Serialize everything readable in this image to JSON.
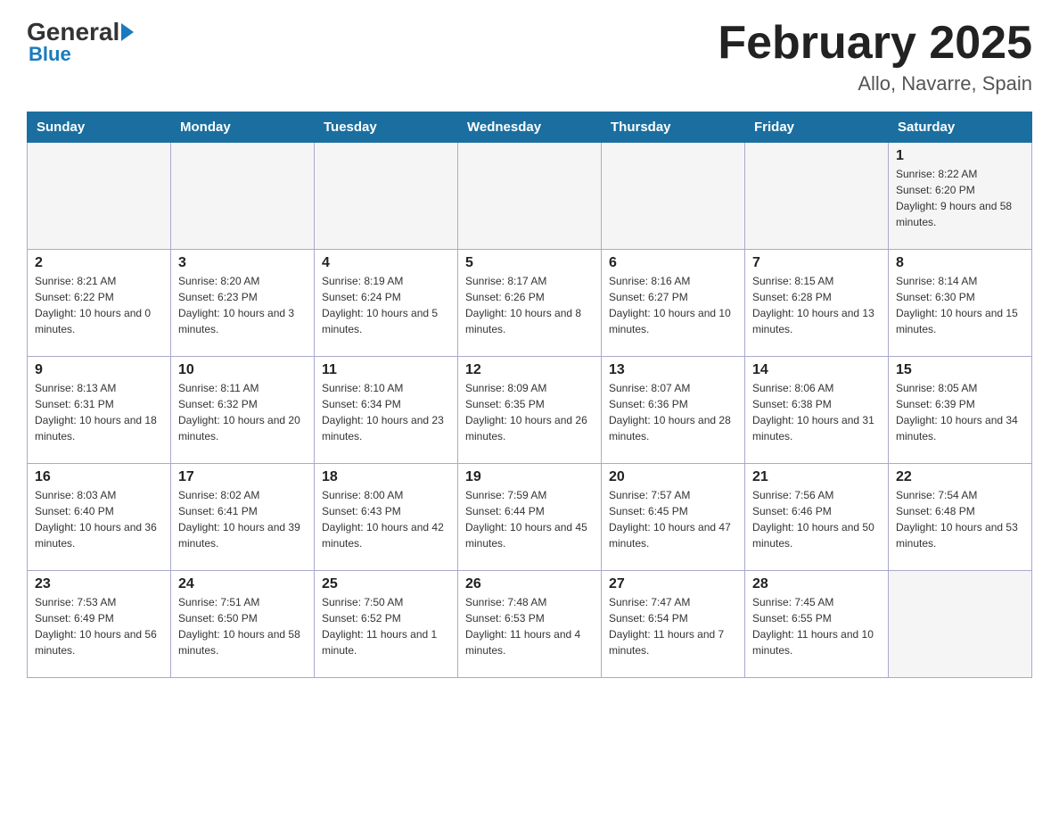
{
  "header": {
    "logo_general": "General",
    "logo_blue": "Blue",
    "month_title": "February 2025",
    "location": "Allo, Navarre, Spain"
  },
  "days_of_week": [
    "Sunday",
    "Monday",
    "Tuesday",
    "Wednesday",
    "Thursday",
    "Friday",
    "Saturday"
  ],
  "weeks": [
    {
      "days": [
        {
          "number": "",
          "info": ""
        },
        {
          "number": "",
          "info": ""
        },
        {
          "number": "",
          "info": ""
        },
        {
          "number": "",
          "info": ""
        },
        {
          "number": "",
          "info": ""
        },
        {
          "number": "",
          "info": ""
        },
        {
          "number": "1",
          "info": "Sunrise: 8:22 AM\nSunset: 6:20 PM\nDaylight: 9 hours and 58 minutes."
        }
      ]
    },
    {
      "days": [
        {
          "number": "2",
          "info": "Sunrise: 8:21 AM\nSunset: 6:22 PM\nDaylight: 10 hours and 0 minutes."
        },
        {
          "number": "3",
          "info": "Sunrise: 8:20 AM\nSunset: 6:23 PM\nDaylight: 10 hours and 3 minutes."
        },
        {
          "number": "4",
          "info": "Sunrise: 8:19 AM\nSunset: 6:24 PM\nDaylight: 10 hours and 5 minutes."
        },
        {
          "number": "5",
          "info": "Sunrise: 8:17 AM\nSunset: 6:26 PM\nDaylight: 10 hours and 8 minutes."
        },
        {
          "number": "6",
          "info": "Sunrise: 8:16 AM\nSunset: 6:27 PM\nDaylight: 10 hours and 10 minutes."
        },
        {
          "number": "7",
          "info": "Sunrise: 8:15 AM\nSunset: 6:28 PM\nDaylight: 10 hours and 13 minutes."
        },
        {
          "number": "8",
          "info": "Sunrise: 8:14 AM\nSunset: 6:30 PM\nDaylight: 10 hours and 15 minutes."
        }
      ]
    },
    {
      "days": [
        {
          "number": "9",
          "info": "Sunrise: 8:13 AM\nSunset: 6:31 PM\nDaylight: 10 hours and 18 minutes."
        },
        {
          "number": "10",
          "info": "Sunrise: 8:11 AM\nSunset: 6:32 PM\nDaylight: 10 hours and 20 minutes."
        },
        {
          "number": "11",
          "info": "Sunrise: 8:10 AM\nSunset: 6:34 PM\nDaylight: 10 hours and 23 minutes."
        },
        {
          "number": "12",
          "info": "Sunrise: 8:09 AM\nSunset: 6:35 PM\nDaylight: 10 hours and 26 minutes."
        },
        {
          "number": "13",
          "info": "Sunrise: 8:07 AM\nSunset: 6:36 PM\nDaylight: 10 hours and 28 minutes."
        },
        {
          "number": "14",
          "info": "Sunrise: 8:06 AM\nSunset: 6:38 PM\nDaylight: 10 hours and 31 minutes."
        },
        {
          "number": "15",
          "info": "Sunrise: 8:05 AM\nSunset: 6:39 PM\nDaylight: 10 hours and 34 minutes."
        }
      ]
    },
    {
      "days": [
        {
          "number": "16",
          "info": "Sunrise: 8:03 AM\nSunset: 6:40 PM\nDaylight: 10 hours and 36 minutes."
        },
        {
          "number": "17",
          "info": "Sunrise: 8:02 AM\nSunset: 6:41 PM\nDaylight: 10 hours and 39 minutes."
        },
        {
          "number": "18",
          "info": "Sunrise: 8:00 AM\nSunset: 6:43 PM\nDaylight: 10 hours and 42 minutes."
        },
        {
          "number": "19",
          "info": "Sunrise: 7:59 AM\nSunset: 6:44 PM\nDaylight: 10 hours and 45 minutes."
        },
        {
          "number": "20",
          "info": "Sunrise: 7:57 AM\nSunset: 6:45 PM\nDaylight: 10 hours and 47 minutes."
        },
        {
          "number": "21",
          "info": "Sunrise: 7:56 AM\nSunset: 6:46 PM\nDaylight: 10 hours and 50 minutes."
        },
        {
          "number": "22",
          "info": "Sunrise: 7:54 AM\nSunset: 6:48 PM\nDaylight: 10 hours and 53 minutes."
        }
      ]
    },
    {
      "days": [
        {
          "number": "23",
          "info": "Sunrise: 7:53 AM\nSunset: 6:49 PM\nDaylight: 10 hours and 56 minutes."
        },
        {
          "number": "24",
          "info": "Sunrise: 7:51 AM\nSunset: 6:50 PM\nDaylight: 10 hours and 58 minutes."
        },
        {
          "number": "25",
          "info": "Sunrise: 7:50 AM\nSunset: 6:52 PM\nDaylight: 11 hours and 1 minute."
        },
        {
          "number": "26",
          "info": "Sunrise: 7:48 AM\nSunset: 6:53 PM\nDaylight: 11 hours and 4 minutes."
        },
        {
          "number": "27",
          "info": "Sunrise: 7:47 AM\nSunset: 6:54 PM\nDaylight: 11 hours and 7 minutes."
        },
        {
          "number": "28",
          "info": "Sunrise: 7:45 AM\nSunset: 6:55 PM\nDaylight: 11 hours and 10 minutes."
        },
        {
          "number": "",
          "info": ""
        }
      ]
    }
  ]
}
